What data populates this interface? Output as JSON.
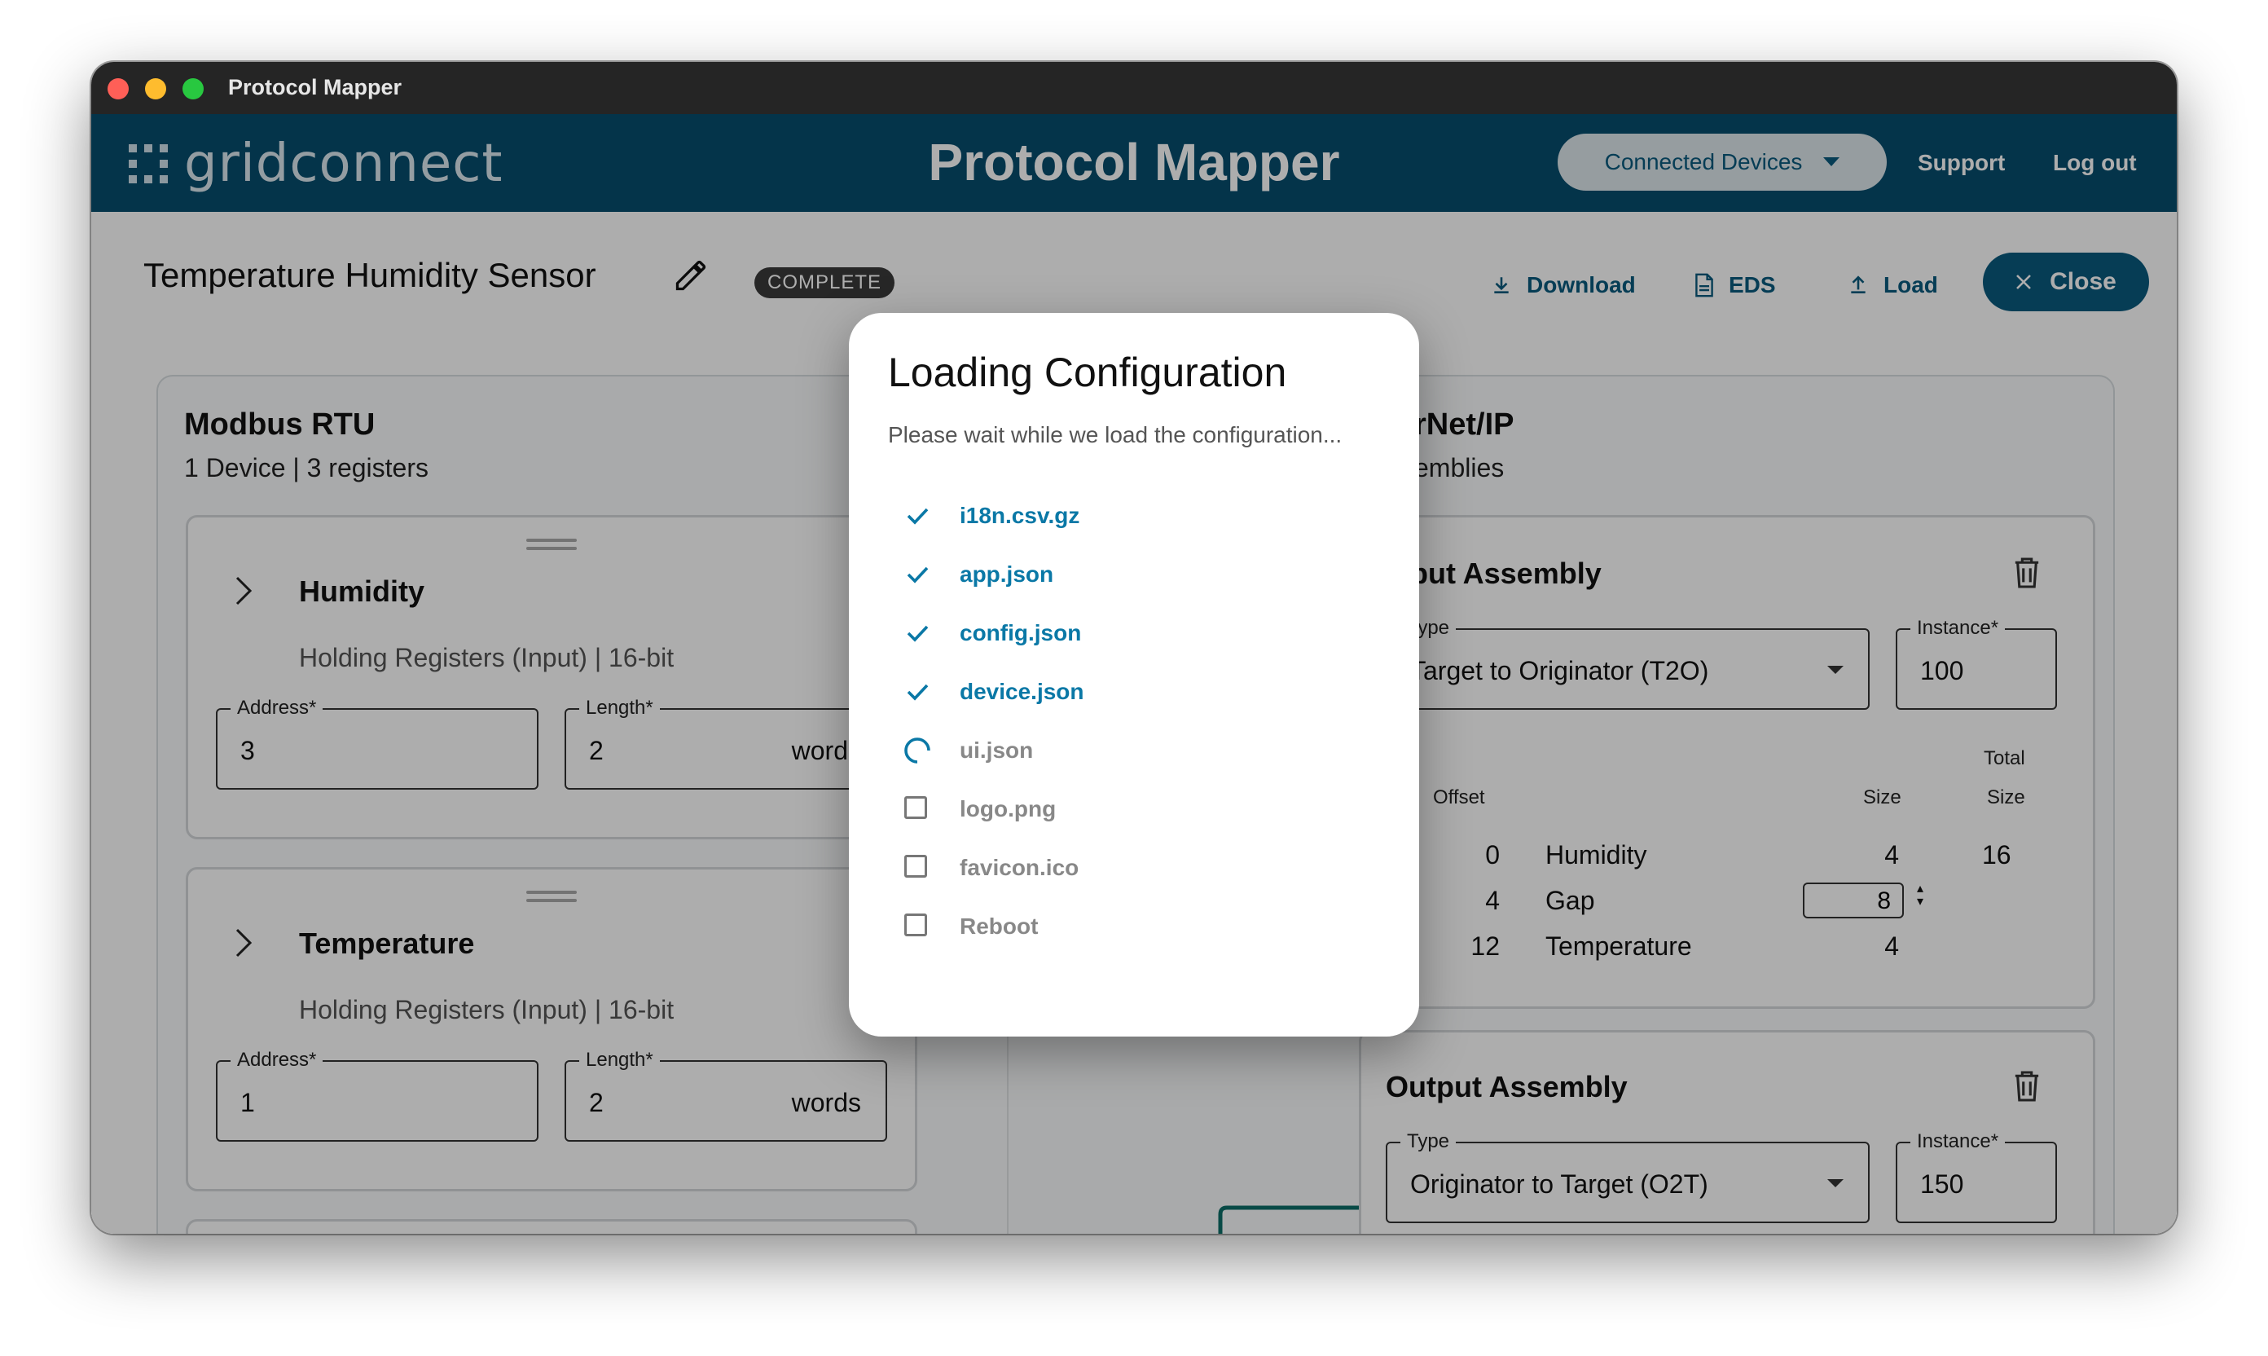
{
  "window": {
    "title": "Protocol Mapper"
  },
  "appbar": {
    "logo_text": "gridconnect",
    "title": "Protocol Mapper",
    "devices_button": "Connected Devices",
    "support": "Support",
    "logout": "Log out"
  },
  "page": {
    "title": "Temperature Humidity Sensor",
    "status_badge": "COMPLETE",
    "toolbar": {
      "download": "Download",
      "eds": "EDS",
      "load": "Load",
      "close": "Close"
    }
  },
  "modbus": {
    "title": "Modbus RTU",
    "subtitle": "1 Device | 3 registers",
    "cards": [
      {
        "name": "Humidity",
        "subtitle": "Holding Registers (Input) | 16-bit",
        "address_label": "Address*",
        "address": "3",
        "length_label": "Length*",
        "length": "2",
        "unit": "words"
      },
      {
        "name": "Temperature",
        "subtitle": "Holding Registers (Input) | 16-bit",
        "address_label": "Address*",
        "address": "1",
        "length_label": "Length*",
        "length": "2",
        "unit": "words"
      }
    ]
  },
  "ethernet": {
    "title": "rNet/IP",
    "subtitle": "emblies",
    "input_assembly": {
      "title": "put Assembly",
      "type_label": "Type",
      "type_value": "Target to Originator (T2O)",
      "instance_label": "Instance*",
      "instance_value": "100",
      "headers": {
        "offset": "Offset",
        "size": "Size",
        "total": "Total",
        "total2": "Size"
      },
      "total_size": "16",
      "rows": [
        {
          "offset": "0",
          "name": "Humidity",
          "size": "4"
        },
        {
          "offset": "4",
          "name": "Gap",
          "size": "8"
        },
        {
          "offset": "12",
          "name": "Temperature",
          "size": "4"
        }
      ]
    },
    "output_assembly": {
      "title": "Output Assembly",
      "type_label": "Type",
      "type_value": "Originator to Target (O2T)",
      "instance_label": "Instance*",
      "instance_value": "150"
    }
  },
  "dialog": {
    "title": "Loading Configuration",
    "subtitle": "Please wait while we load the configuration...",
    "files": [
      {
        "name": "i18n.csv.gz",
        "status": "done"
      },
      {
        "name": "app.json",
        "status": "done"
      },
      {
        "name": "config.json",
        "status": "done"
      },
      {
        "name": "device.json",
        "status": "done"
      },
      {
        "name": "ui.json",
        "status": "loading"
      },
      {
        "name": "logo.png",
        "status": "pending"
      },
      {
        "name": "favicon.ico",
        "status": "pending"
      },
      {
        "name": "Reboot",
        "status": "pending"
      }
    ]
  },
  "colors": {
    "brand": "#074d6e",
    "accent": "#0a78a6",
    "close_button": "#0a5a7e"
  }
}
